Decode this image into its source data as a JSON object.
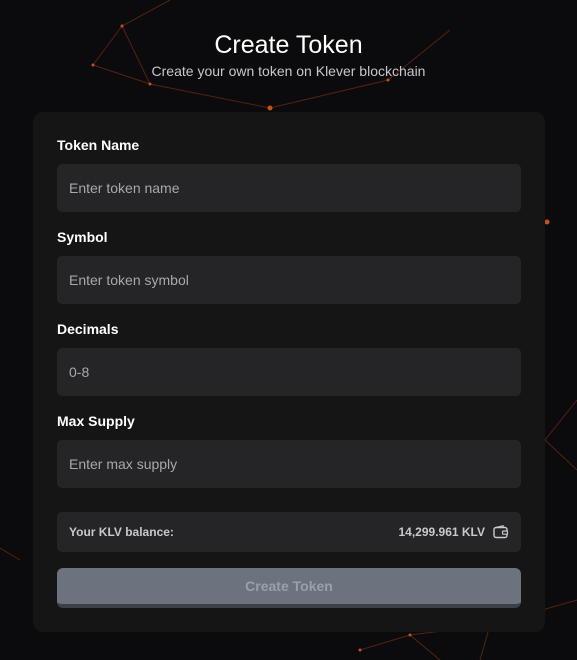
{
  "header": {
    "title": "Create Token",
    "subtitle": "Create your own token on Klever blockchain"
  },
  "form": {
    "token_name": {
      "label": "Token Name",
      "placeholder": "Enter token name",
      "value": ""
    },
    "symbol": {
      "label": "Symbol",
      "placeholder": "Enter token symbol",
      "value": ""
    },
    "decimals": {
      "label": "Decimals",
      "placeholder": "0-8",
      "value": ""
    },
    "max_supply": {
      "label": "Max Supply",
      "placeholder": "Enter max supply",
      "value": ""
    }
  },
  "balance": {
    "label": "Your KLV balance:",
    "value": "14,299.961 KLV",
    "icon": "wallet-icon"
  },
  "submit": {
    "label": "Create Token",
    "disabled": true
  },
  "colors": {
    "background": "#0b0b0d",
    "card": "#151516",
    "input": "#252527",
    "button_disabled": "#6c737f",
    "network_accent": "#c2511a"
  }
}
